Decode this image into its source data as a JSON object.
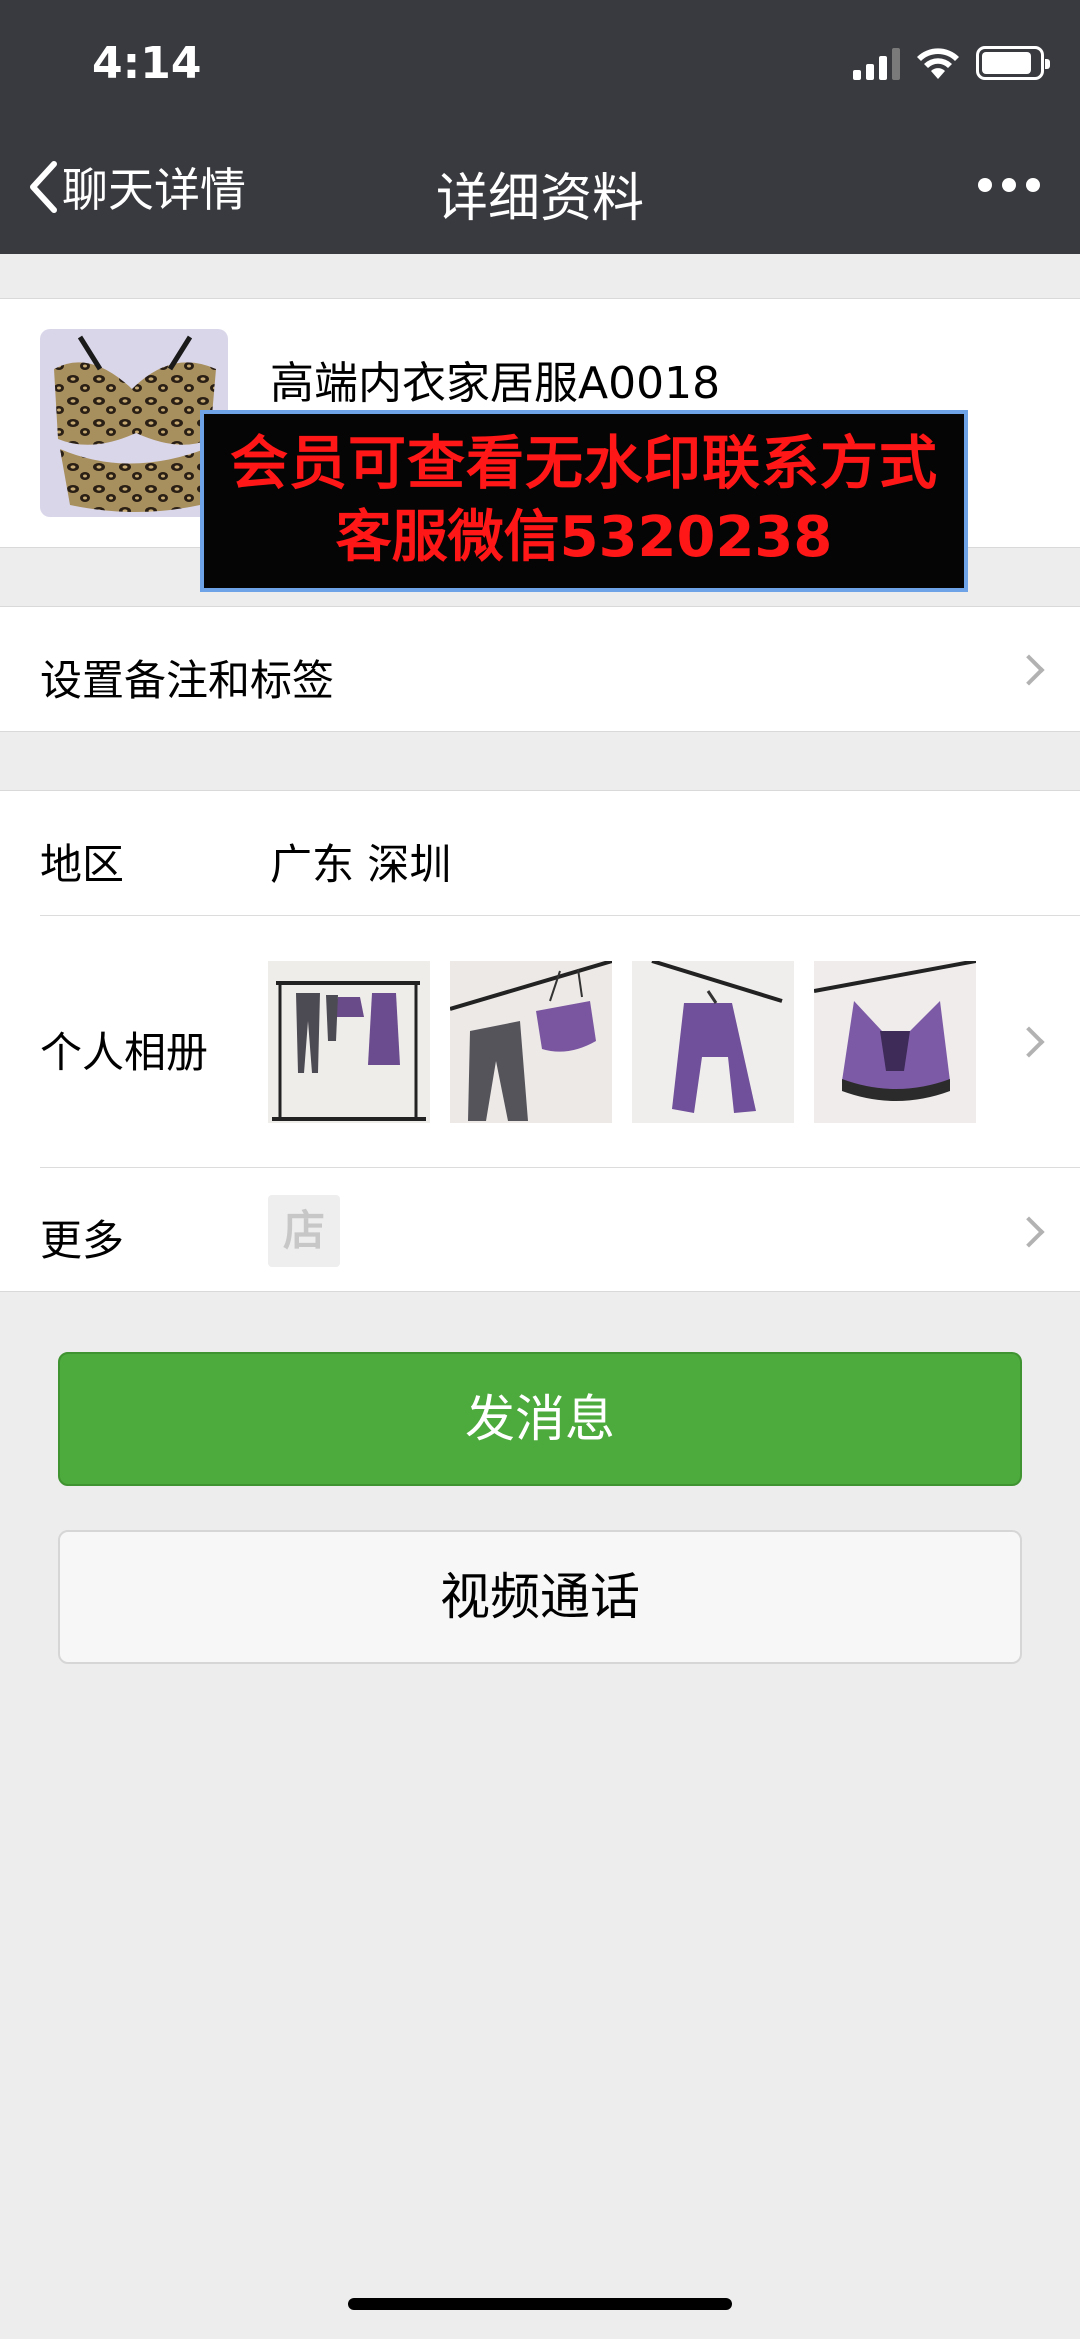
{
  "status_bar": {
    "time": "4:14"
  },
  "nav": {
    "back_label": "聊天详情",
    "title": "详细资料"
  },
  "profile": {
    "name": "高端内衣家居服A0018"
  },
  "watermark": {
    "line1": "会员可查看无水印联系方式",
    "line2": "客服微信5320238"
  },
  "rows": {
    "remark_label": "设置备注和标签",
    "region_label": "地区",
    "region_value": "广东  深圳",
    "album_label": "个人相册",
    "more_label": "更多",
    "shop_icon_text": "店"
  },
  "buttons": {
    "message": "发消息",
    "video_call": "视频通话"
  },
  "colors": {
    "nav_bg": "#393a3f",
    "primary_green": "#4daa3c",
    "page_bg": "#ededed",
    "watermark_red": "#ff1616"
  }
}
